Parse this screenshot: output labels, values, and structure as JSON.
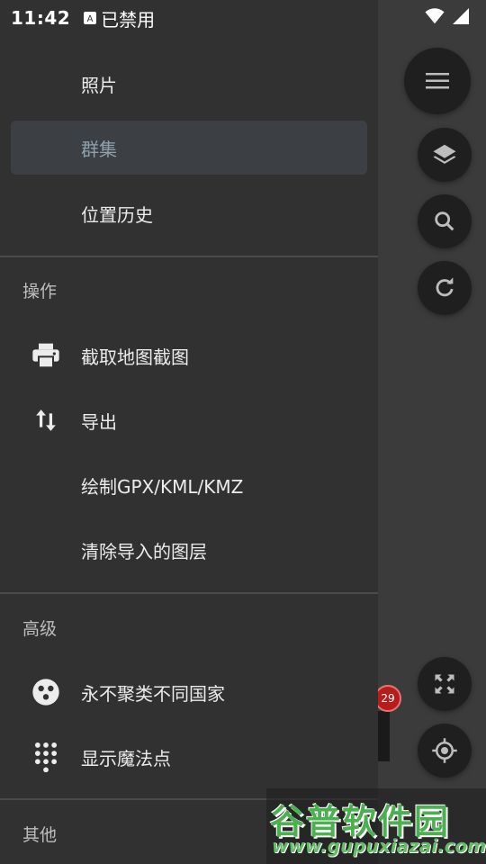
{
  "status_bar": {
    "time": "11:42",
    "notification_text": "已禁用",
    "icons": [
      "wifi-icon",
      "signal-icon"
    ]
  },
  "drawer": {
    "top_items": [
      {
        "label": "照片",
        "selected": false
      },
      {
        "label": "群集",
        "selected": true
      },
      {
        "label": "位置历史",
        "selected": false
      }
    ],
    "sections": [
      {
        "title": "操作",
        "items": [
          {
            "label": "截取地图截图",
            "icon": "printer-icon"
          },
          {
            "label": "导出",
            "icon": "swap-vertical-icon"
          },
          {
            "label": "绘制GPX/KML/KMZ",
            "icon": ""
          },
          {
            "label": "清除导入的图层",
            "icon": ""
          }
        ]
      },
      {
        "title": "高级",
        "items": [
          {
            "label": "永不聚类不同国家",
            "icon": "cluster-dots-icon"
          },
          {
            "label": "显示魔法点",
            "icon": "dot-grid-icon"
          }
        ]
      },
      {
        "title": "其他",
        "items": []
      }
    ]
  },
  "map": {
    "buttons": [
      "menu-icon",
      "layers-icon",
      "search-icon",
      "refresh-icon",
      "fullscreen-icon",
      "my-location-icon"
    ],
    "cluster_count": "29"
  },
  "watermark": {
    "title": "谷普软件园",
    "url": "www.gupuxiazai.com"
  }
}
